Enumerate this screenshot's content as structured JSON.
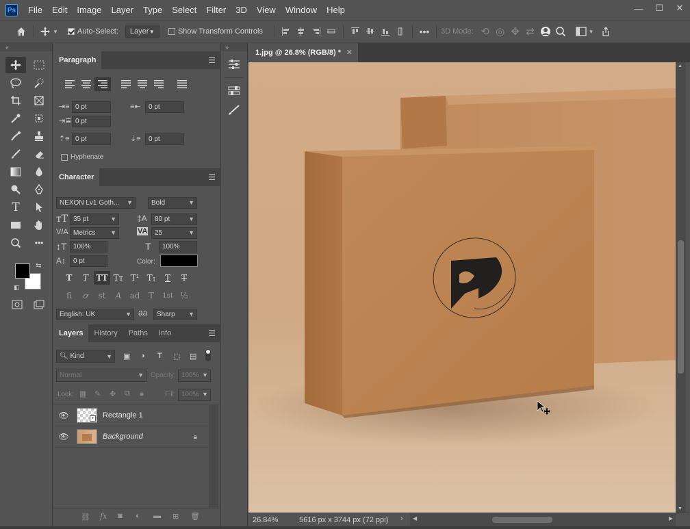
{
  "app": {
    "logo": "Ps"
  },
  "menu": [
    "File",
    "Edit",
    "Image",
    "Layer",
    "Type",
    "Select",
    "Filter",
    "3D",
    "View",
    "Window",
    "Help"
  ],
  "window_buttons": {
    "minimize": "—",
    "maximize": "☐",
    "close": "✕"
  },
  "options_bar": {
    "auto_select_label": "Auto-Select:",
    "auto_select_checked": true,
    "auto_select_target": "Layer",
    "show_transform_label": "Show Transform Controls",
    "three_d_mode_label": "3D Mode:"
  },
  "paragraph": {
    "tab": "Paragraph",
    "indent_left": "0 pt",
    "indent_right": "0 pt",
    "indent_first": "0 pt",
    "space_before": "0 pt",
    "space_after": "0 pt",
    "hyphenate_label": "Hyphenate"
  },
  "character": {
    "tab": "Character",
    "font_family": "NEXON Lv1 Goth...",
    "font_style": "Bold",
    "font_size": "35 pt",
    "leading": "80 pt",
    "kerning": "Metrics",
    "tracking": "25",
    "vertical_scale": "100%",
    "horizontal_scale": "100%",
    "baseline_shift": "0 pt",
    "color_label": "Color:",
    "color_value": "#000000",
    "language": "English: UK",
    "antialias_icon": "aa",
    "antialias": "Sharp",
    "style_buttons": [
      "T",
      "T",
      "TT",
      "Tт",
      "T¹",
      "T₁",
      "T",
      "T"
    ],
    "opentype_buttons": [
      "fi",
      "ơ",
      "st",
      "A",
      "ad",
      "T",
      "1st",
      "½"
    ]
  },
  "layers": {
    "tabs": [
      "Layers",
      "History",
      "Paths",
      "Info"
    ],
    "filter_kind": "Kind",
    "blend_mode": "Normal",
    "opacity_label": "Opacity:",
    "opacity": "100%",
    "lock_label": "Lock:",
    "fill_label": "Fill:",
    "fill": "100%",
    "items": [
      {
        "name": "Rectangle 1",
        "locked": false,
        "italic": false
      },
      {
        "name": "Background",
        "locked": true,
        "italic": true
      }
    ]
  },
  "document": {
    "tab_title": "1.jpg @ 26.8% (RGB/8) *",
    "close_glyph": "✕"
  },
  "status": {
    "zoom": "26.84%",
    "doc_info": "5616 px x 3744 px (72 ppi)"
  },
  "colors": {
    "foreground": "#000000",
    "background": "#ffffff",
    "accent": "#31a8ff"
  }
}
